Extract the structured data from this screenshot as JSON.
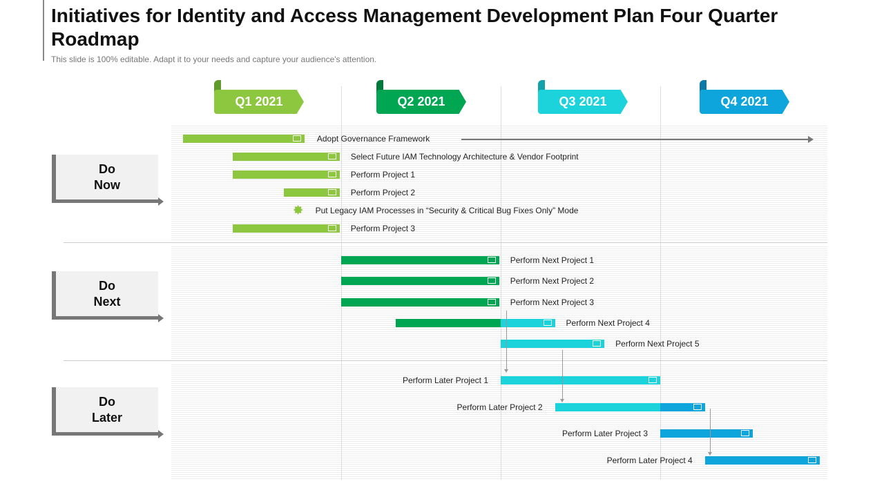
{
  "title": "Initiatives for Identity and Access Management Development Plan Four Quarter Roadmap",
  "subtitle": "This slide is 100% editable. Adapt it to your needs and capture your audience's attention.",
  "colors": {
    "q1": "#8dc63f",
    "q2": "#00a651",
    "q3": "#1cd3dc",
    "q4": "#0ea5dc"
  },
  "quarters": [
    "Q1 2021",
    "Q2 2021",
    "Q3 2021",
    "Q4 2021"
  ],
  "categories": [
    "Do\nNow",
    "Do\nNext",
    "Do\nLater"
  ],
  "chart_data": {
    "type": "gantt",
    "x_unit": "quarter index (0 = start of Q1 2021)",
    "tasks": [
      {
        "label": "Adopt Governance Framework",
        "segments": [
          [
            0.01,
            0.77,
            "q1"
          ]
        ],
        "label_side": "right",
        "arrow_to_end": true
      },
      {
        "label": "Select Future IAM Technology Architecture & Vendor Footprint",
        "segments": [
          [
            0.32,
            0.99,
            "q1"
          ]
        ],
        "label_side": "right"
      },
      {
        "label": "Perform Project 1",
        "segments": [
          [
            0.32,
            0.99,
            "q1"
          ]
        ],
        "label_side": "right"
      },
      {
        "label": "Perform Project 2",
        "segments": [
          [
            0.64,
            0.99,
            "q1"
          ]
        ],
        "label_side": "right"
      },
      {
        "label": "Put Legacy IAM Processes in “Security & Critical Bug Fixes Only” Mode",
        "milestone": 0.73,
        "segments": [],
        "label_side": "right"
      },
      {
        "label": "Perform Project 3",
        "segments": [
          [
            0.32,
            0.99,
            "q1"
          ]
        ],
        "label_side": "right"
      },
      {
        "label": "Perform Next  Project 1",
        "segments": [
          [
            1.0,
            1.99,
            "q2"
          ]
        ],
        "label_side": "right"
      },
      {
        "label": "Perform Next  Project 2",
        "segments": [
          [
            1.0,
            1.99,
            "q2"
          ]
        ],
        "label_side": "right"
      },
      {
        "label": "Perform Next  Project 3",
        "segments": [
          [
            1.0,
            1.99,
            "q2"
          ]
        ],
        "label_side": "right"
      },
      {
        "label": "Perform Next  Project 4",
        "segments": [
          [
            1.34,
            2.0,
            "q2"
          ],
          [
            2.0,
            2.34,
            "q3"
          ]
        ],
        "label_side": "right"
      },
      {
        "label": "Perform Next Project 5",
        "segments": [
          [
            2.0,
            2.65,
            "q3"
          ]
        ],
        "label_side": "right"
      },
      {
        "label": "Perform Later  Project 1",
        "segments": [
          [
            2.0,
            3.0,
            "q3"
          ]
        ],
        "label_side": "left"
      },
      {
        "label": "Perform Later  Project 2",
        "segments": [
          [
            2.34,
            3.0,
            "q3"
          ],
          [
            3.0,
            3.28,
            "q4"
          ]
        ],
        "label_side": "left"
      },
      {
        "label": "Perform Later  Project 3",
        "segments": [
          [
            3.0,
            3.58,
            "q4"
          ]
        ],
        "label_side": "left"
      },
      {
        "label": "Perform Later  Project 4",
        "segments": [
          [
            3.28,
            4.0,
            "q4"
          ]
        ],
        "label_side": "left"
      }
    ]
  }
}
